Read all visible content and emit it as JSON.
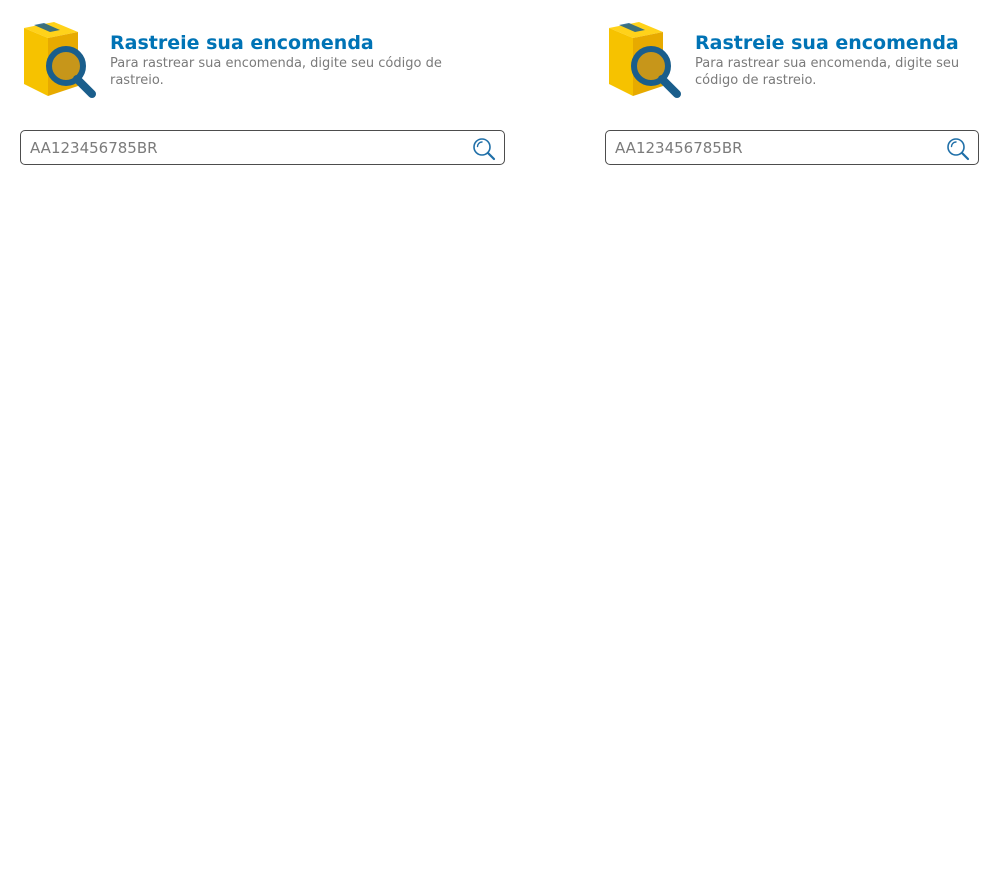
{
  "widgets": [
    {
      "logo_icon": "package-magnifier-icon",
      "title": "Rastreie sua encomenda",
      "subtitle": "Para rastrear sua encomenda, digite seu código de rastreio.",
      "search": {
        "placeholder": "AA123456785BR",
        "value": "",
        "button_icon": "search-icon"
      }
    },
    {
      "logo_icon": "package-magnifier-icon",
      "title": "Rastreie sua encomenda",
      "subtitle": "Para rastrear sua encomenda, digite seu código de rastreio.",
      "search": {
        "placeholder": "AA123456785BR",
        "value": "",
        "button_icon": "search-icon"
      }
    }
  ],
  "colors": {
    "title": "#0073b5",
    "subtitle": "#7a7a7a",
    "box_yellow": "#f6c200",
    "box_dark_yellow": "#d99e00",
    "lens_blue": "#1a5e8c",
    "search_icon": "#1f6fa8",
    "input_border": "#4d4d4d"
  }
}
